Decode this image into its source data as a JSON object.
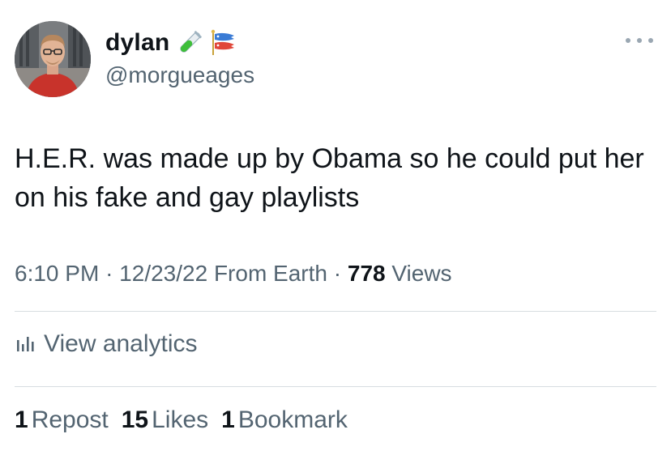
{
  "author": {
    "display_name": "dylan",
    "handle": "@morgueages",
    "badges": [
      "test-tube-icon",
      "carp-streamer-icon"
    ]
  },
  "tweet": {
    "text": "H.E.R. was made up by Obama so he could put her on his fake and gay playlists",
    "time": "6:10 PM",
    "date": "12/23/22",
    "source": "From Earth",
    "views_count": "778",
    "views_label": "Views"
  },
  "analytics": {
    "label": "View analytics"
  },
  "stats": {
    "reposts_count": "1",
    "reposts_label": "Repost",
    "likes_count": "15",
    "likes_label": "Likes",
    "bookmarks_count": "1",
    "bookmarks_label": "Bookmark"
  },
  "colors": {
    "text_primary": "#0f1419",
    "text_secondary": "#536471",
    "divider": "#d7dde1"
  }
}
